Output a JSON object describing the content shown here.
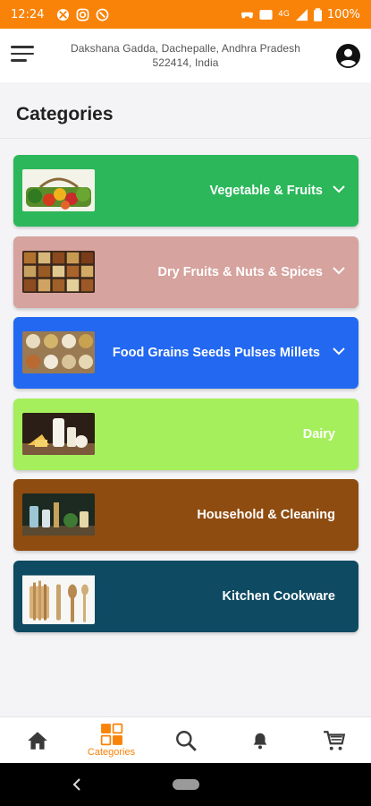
{
  "status_bar": {
    "time": "12:24",
    "battery": "100%",
    "network": "4G"
  },
  "header": {
    "address_line1": "Dakshana Gadda, Dachepalle, Andhra Pradesh",
    "address_line2": "522414, India"
  },
  "page": {
    "title": "Categories"
  },
  "categories": [
    {
      "label": "Vegetable & Fruits",
      "color": "#2cb75a",
      "has_dropdown": true
    },
    {
      "label": "Dry Fruits & Nuts & Spices",
      "color": "#d6a39e",
      "has_dropdown": true
    },
    {
      "label": "Food Grains Seeds Pulses Millets",
      "color": "#2368f0",
      "has_dropdown": true
    },
    {
      "label": "Dairy",
      "color": "#a4ef5b",
      "has_dropdown": false
    },
    {
      "label": "Household & Cleaning",
      "color": "#8f4c10",
      "has_dropdown": false
    },
    {
      "label": "Kitchen Cookware",
      "color": "#0f4a63",
      "has_dropdown": false
    }
  ],
  "bottom_nav": {
    "items": [
      {
        "icon": "home-icon",
        "label": ""
      },
      {
        "icon": "categories-icon",
        "label": "Categories",
        "active": true
      },
      {
        "icon": "search-icon",
        "label": ""
      },
      {
        "icon": "bell-icon",
        "label": ""
      },
      {
        "icon": "cart-icon",
        "label": ""
      }
    ],
    "accent": "#f98208"
  }
}
